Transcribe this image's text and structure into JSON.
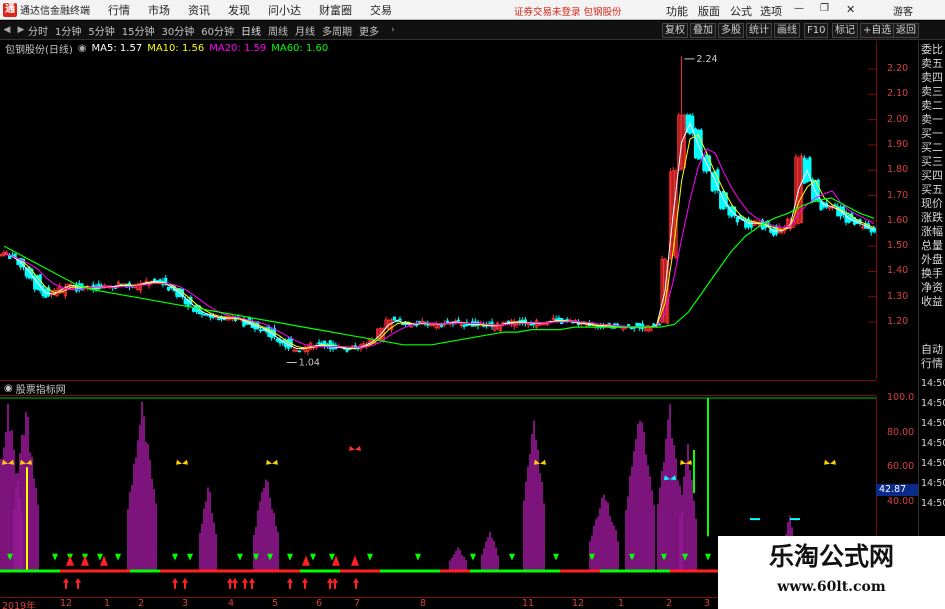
{
  "titlebar": {
    "app_name": "通达信金融终端",
    "menus": [
      "行情",
      "市场",
      "资讯",
      "发现",
      "问小达",
      "财富圈",
      "交易"
    ],
    "warning": "证券交易未登录  包钢股份",
    "right_menus": [
      "功能",
      "版面",
      "公式",
      "选项"
    ],
    "guest": "游客"
  },
  "toolbar": {
    "periods": [
      "分时",
      "1分钟",
      "5分钟",
      "15分钟",
      "30分钟",
      "60分钟",
      "日线",
      "周线",
      "月线",
      "多周期",
      "更多"
    ],
    "active_period": "日线",
    "buttons": [
      "复权",
      "叠加",
      "多股",
      "统计",
      "画线",
      "F10",
      "标记",
      "+自选",
      "返回"
    ]
  },
  "stock": {
    "title": "包钢股份(日线)",
    "ma": [
      {
        "label": "MA5: 1.57",
        "color": "#ffffff"
      },
      {
        "label": "MA10: 1.56",
        "color": "#ffff00"
      },
      {
        "label": "MA20: 1.59",
        "color": "#ff00ff"
      },
      {
        "label": "MA60: 1.60",
        "color": "#00ff00"
      }
    ],
    "high_label": "2.24",
    "low_label": "1.04"
  },
  "yaxis_main": [
    "2.20",
    "2.10",
    "2.00",
    "1.90",
    "1.80",
    "1.70",
    "1.60",
    "1.50",
    "1.40",
    "1.30",
    "1.20"
  ],
  "indicator": {
    "title": "股票指标网",
    "yaxis": [
      "100.0",
      "80.00",
      "60.00",
      "40.00"
    ],
    "current_value": "42.87"
  },
  "sidebar": [
    "委比",
    "卖五",
    "卖四",
    "卖三",
    "卖二",
    "卖一",
    "买一",
    "买二",
    "买三",
    "买四",
    "买五",
    "现价",
    "涨跌",
    "涨幅",
    "总量",
    "外盘",
    "换手",
    "净资",
    "收益",
    "自动",
    "行情",
    "14:50",
    "14:50",
    "14:50",
    "14:50",
    "14:50",
    "14:50",
    "14:50"
  ],
  "dates": [
    "2019年",
    "12",
    "1",
    "2",
    "3",
    "4",
    "5",
    "6",
    "7",
    "8",
    "11",
    "12",
    "1",
    "2",
    "3"
  ],
  "watermark": {
    "line1": "乐淘公式网",
    "line2": "www.60lt.com"
  },
  "colors": {
    "up": "#ff3232",
    "down": "#00ffff",
    "ma5": "#ffffff",
    "ma10": "#ffff00",
    "ma20": "#ff00ff",
    "ma60": "#00ff00",
    "axis": "#d84040",
    "bar": "#c020c0"
  },
  "chart_data": {
    "type": "candlestick",
    "title": "包钢股份(日线)",
    "ylim": [
      1.0,
      2.28
    ],
    "close_series": [
      1.47,
      1.45,
      1.42,
      1.38,
      1.33,
      1.3,
      1.32,
      1.34,
      1.35,
      1.33,
      1.34,
      1.33,
      1.34,
      1.34,
      1.35,
      1.34,
      1.35,
      1.36,
      1.36,
      1.35,
      1.33,
      1.3,
      1.27,
      1.24,
      1.23,
      1.22,
      1.21,
      1.22,
      1.21,
      1.19,
      1.18,
      1.17,
      1.14,
      1.12,
      1.1,
      1.09,
      1.1,
      1.11,
      1.11,
      1.1,
      1.1,
      1.09,
      1.1,
      1.11,
      1.13,
      1.17,
      1.21,
      1.2,
      1.19,
      1.19,
      1.2,
      1.19,
      1.19,
      1.2,
      1.2,
      1.19,
      1.19,
      1.19,
      1.18,
      1.19,
      1.2,
      1.2,
      1.2,
      1.19,
      1.2,
      1.2,
      1.21,
      1.2,
      1.2,
      1.19,
      1.19,
      1.18,
      1.19,
      1.18,
      1.18,
      1.18,
      1.18,
      1.18,
      1.19,
      1.45,
      1.8,
      2.02,
      1.95,
      1.85,
      1.8,
      1.72,
      1.65,
      1.62,
      1.6,
      1.58,
      1.6,
      1.57,
      1.55,
      1.57,
      1.6,
      1.85,
      1.75,
      1.68,
      1.65,
      1.66,
      1.62,
      1.6,
      1.59,
      1.57,
      1.56
    ],
    "ma60_series": [
      1.5,
      1.47,
      1.44,
      1.41,
      1.38,
      1.35,
      1.33,
      1.32,
      1.31,
      1.3,
      1.29,
      1.28,
      1.27,
      1.26,
      1.25,
      1.24,
      1.23,
      1.22,
      1.21,
      1.2,
      1.19,
      1.18,
      1.17,
      1.16,
      1.15,
      1.14,
      1.13,
      1.12,
      1.11,
      1.11,
      1.11,
      1.12,
      1.13,
      1.14,
      1.15,
      1.16,
      1.16,
      1.17,
      1.17,
      1.17,
      1.18,
      1.18,
      1.18,
      1.18,
      1.18,
      1.18,
      1.18,
      1.19,
      1.24,
      1.32,
      1.4,
      1.48,
      1.54,
      1.58,
      1.61,
      1.63,
      1.66,
      1.68,
      1.69,
      1.66,
      1.63,
      1.61
    ],
    "annotations": [
      {
        "label": "2.24",
        "value": 2.24
      },
      {
        "label": "1.04",
        "value": 1.04
      }
    ]
  }
}
